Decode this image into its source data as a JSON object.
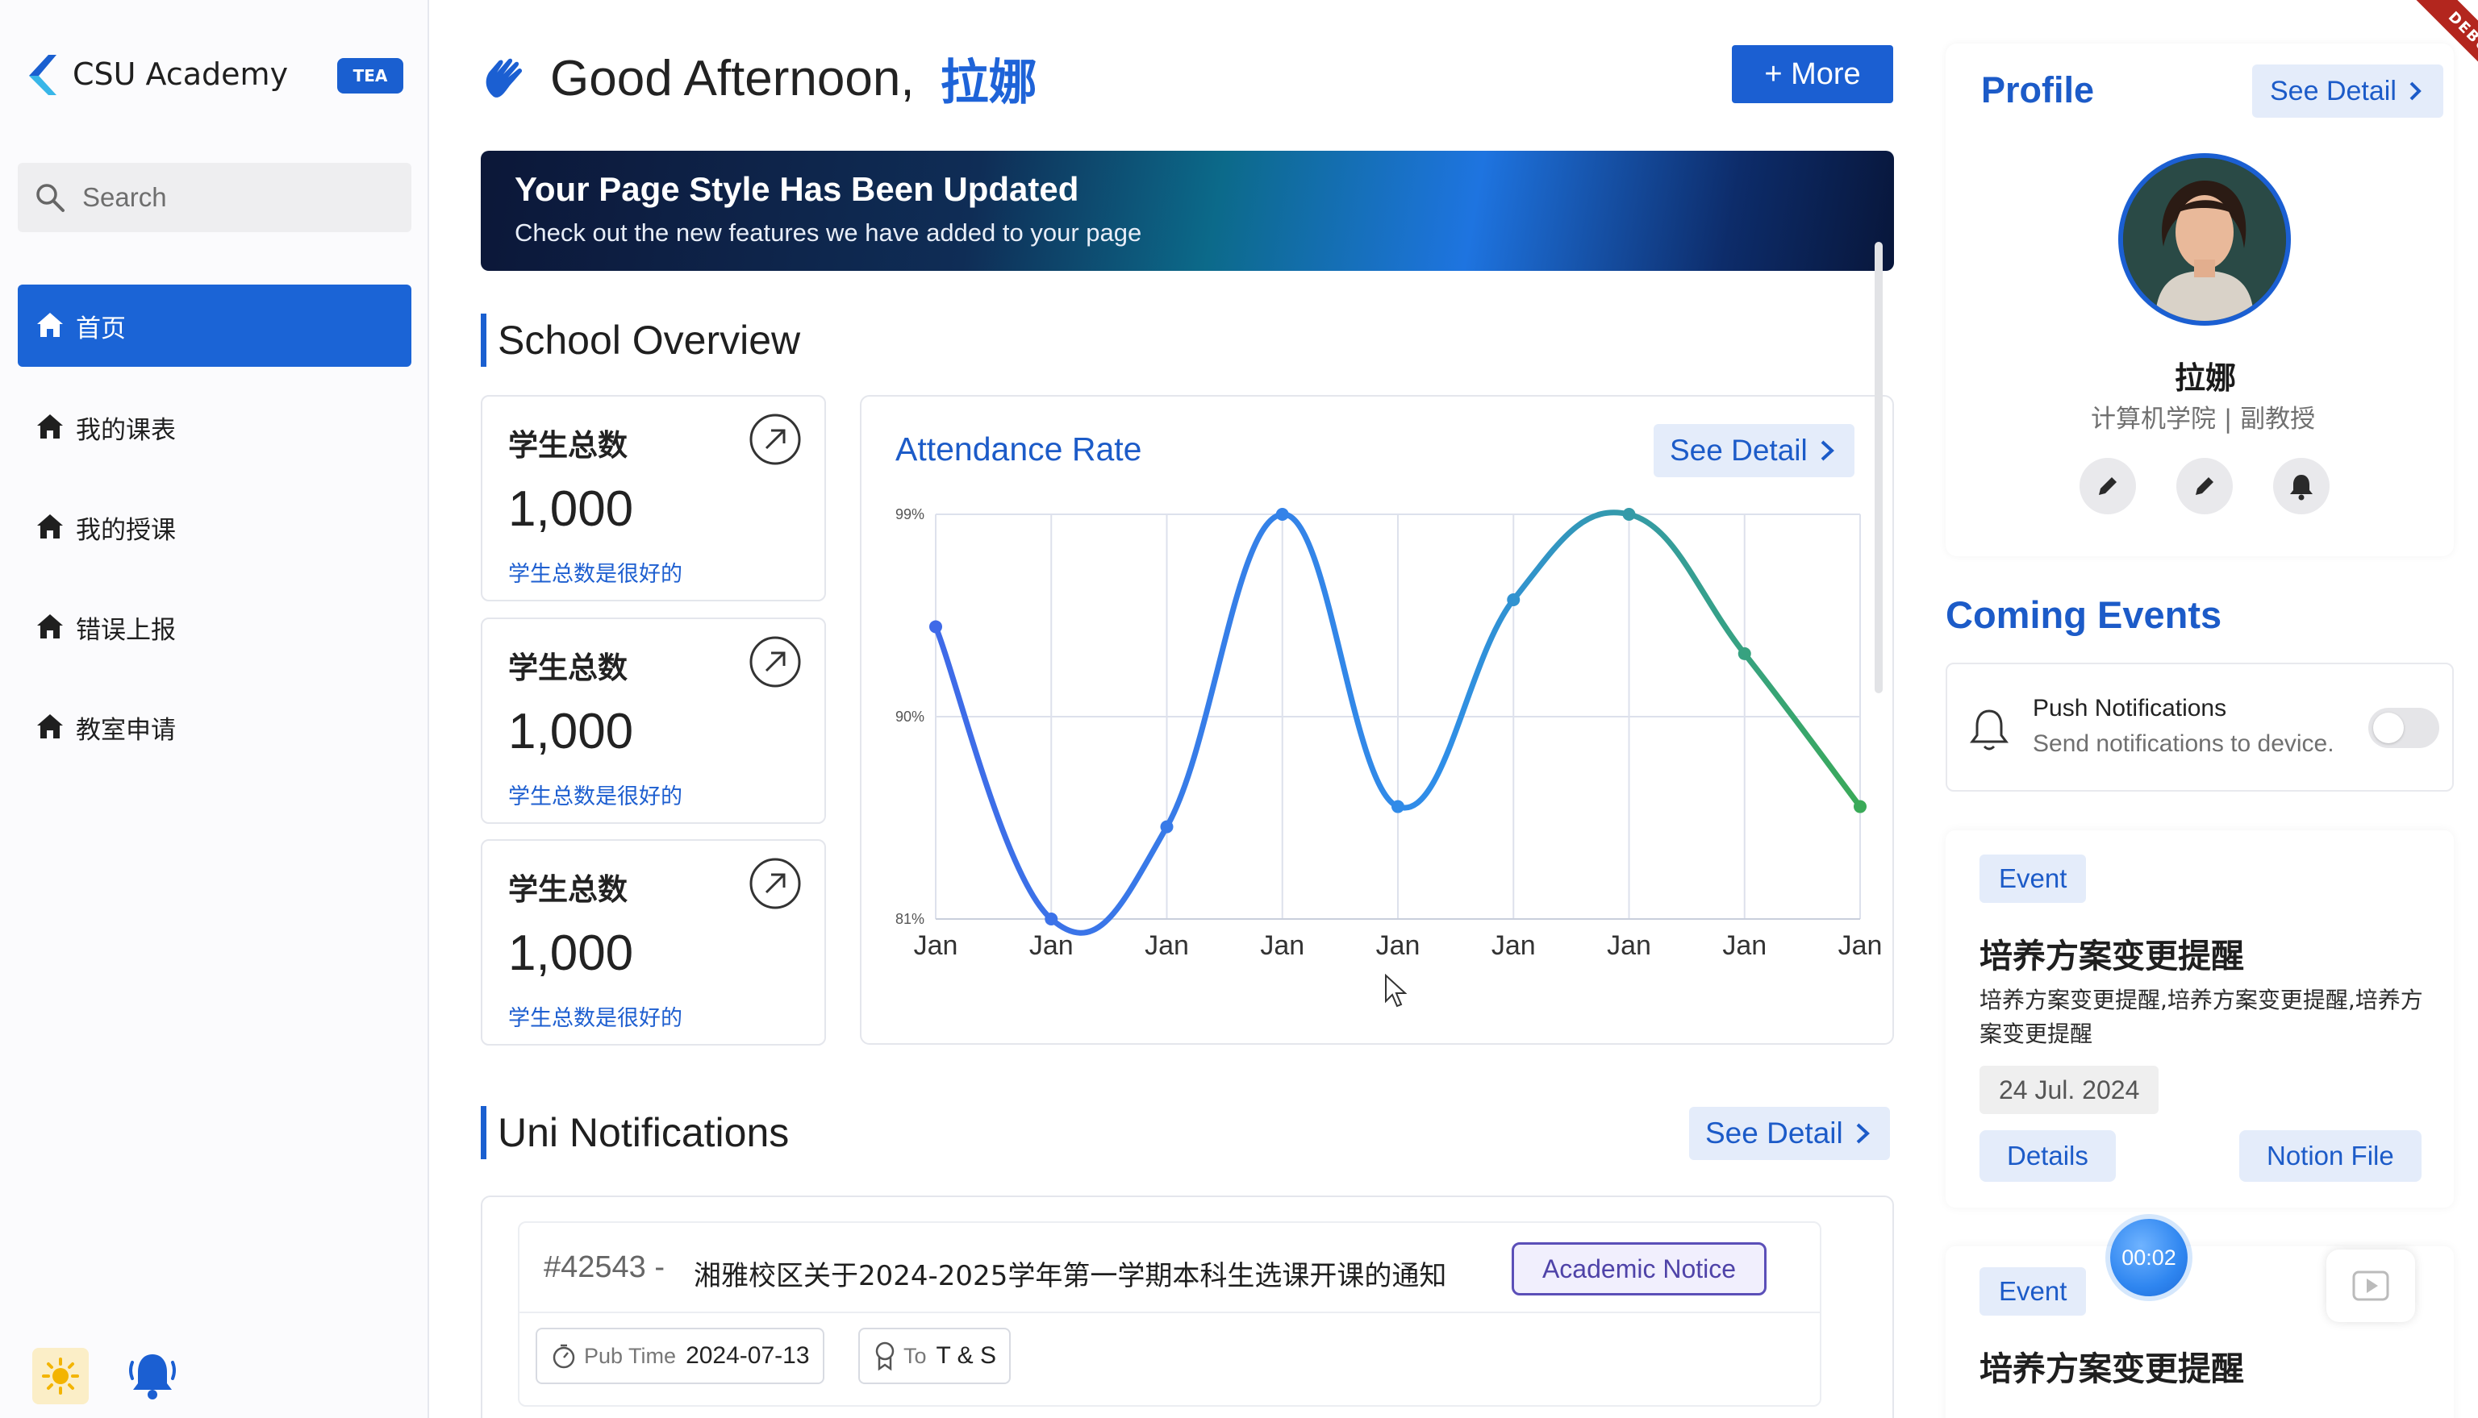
{
  "sidebar": {
    "brand": "CSU Academy",
    "badge": "TEA",
    "search_placeholder": "Search",
    "items": [
      {
        "label": "首页"
      },
      {
        "label": "我的课表"
      },
      {
        "label": "我的授课"
      },
      {
        "label": "错误上报"
      },
      {
        "label": "教室申请"
      }
    ]
  },
  "header": {
    "greeting": "Good Afternoon,",
    "name": "拉娜",
    "more_button": "+ More"
  },
  "banner": {
    "title": "Your Page Style Has Been Updated",
    "subtitle": "Check out the new features we have added to your page"
  },
  "overview": {
    "title": "School Overview",
    "stats": [
      {
        "label": "学生总数",
        "value": "1,000",
        "note": "学生总数是很好的"
      },
      {
        "label": "学生总数",
        "value": "1,000",
        "note": "学生总数是很好的"
      },
      {
        "label": "学生总数",
        "value": "1,000",
        "note": "学生总数是很好的"
      }
    ]
  },
  "attendance": {
    "title": "Attendance Rate",
    "see_detail": "See Detail"
  },
  "chart_data": {
    "type": "line",
    "title": "Attendance Rate",
    "categories": [
      "Jan",
      "Jan",
      "Jan",
      "Jan",
      "Jan",
      "Jan",
      "Jan",
      "Jan",
      "Jan"
    ],
    "ytick_labels": [
      "99%",
      "90%",
      "81%"
    ],
    "ylim": [
      81,
      99
    ],
    "series": [
      {
        "values": [
          94.0,
          81.0,
          85.1,
          99.0,
          86.0,
          95.2,
          99.0,
          92.8,
          86.0
        ]
      }
    ],
    "grid": true,
    "colors": {
      "start": "#3f6ae8",
      "end": "#3aaa58"
    }
  },
  "notifications": {
    "title": "Uni Notifications",
    "see_detail": "See Detail",
    "items": [
      {
        "id": "#42543 -",
        "title": "湘雅校区关于2024-2025学年第一学期本科生选课开课的通知",
        "tag": "Academic Notice",
        "pub_label": "Pub Time",
        "pub_time": "2024-07-13",
        "to_label": "To",
        "to_value": "T & S"
      }
    ]
  },
  "profile": {
    "title": "Profile",
    "see_detail": "See Detail",
    "name": "拉娜",
    "role": "计算机学院 | 副教授"
  },
  "events": {
    "title": "Coming Events",
    "push": {
      "title": "Push Notifications",
      "subtitle": "Send notifications to device.",
      "enabled": false
    },
    "items": [
      {
        "tag": "Event",
        "title": "培养方案变更提醒",
        "desc": "培养方案变更提醒,培养方案变更提醒,培养方案变更提醒",
        "date": "24 Jul. 2024",
        "details_btn": "Details",
        "notion_btn": "Notion File"
      },
      {
        "tag": "Event",
        "title": "培养方案变更提醒"
      }
    ]
  },
  "overlay": {
    "timer": "00:02",
    "debug": "DEBUG"
  },
  "colors": {
    "accent": "#1b5fd2",
    "accent_text": "#1c5bc8",
    "tag_purple": "#5b4fb8"
  }
}
